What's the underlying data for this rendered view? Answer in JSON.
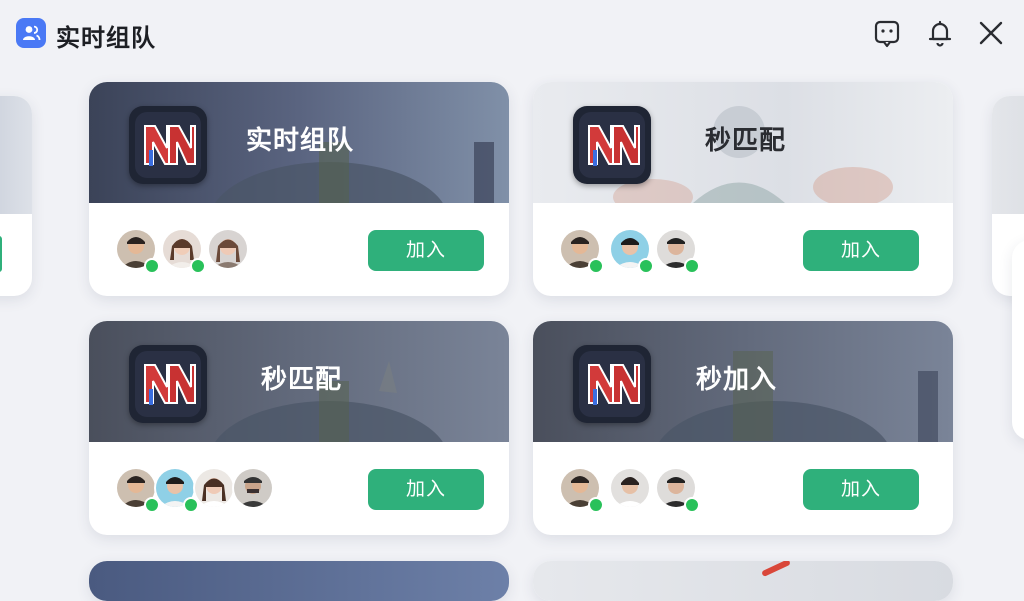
{
  "header": {
    "title": "实时组队",
    "icons": [
      "team-icon",
      "feedback-icon",
      "bell-icon",
      "close-icon"
    ]
  },
  "cards": [
    {
      "mode": "实时组队",
      "button": "加入",
      "banner_theme": "dark",
      "avatars": [
        {
          "online": true
        },
        {
          "online": true
        },
        {
          "online": false
        }
      ]
    },
    {
      "mode": "秒匹配",
      "button": "加入",
      "banner_theme": "light",
      "avatars": [
        {
          "online": true
        },
        {
          "online": true
        },
        {
          "online": true
        }
      ]
    },
    {
      "mode": "秒匹配",
      "button": "加入",
      "banner_theme": "dark",
      "avatars": [
        {
          "online": true
        },
        {
          "online": true
        },
        {
          "online": false
        },
        {
          "online": false
        }
      ]
    },
    {
      "mode": "秒加入",
      "button": "加入",
      "banner_theme": "dark",
      "avatars": [
        {
          "online": true
        },
        {
          "online": false
        },
        {
          "online": true
        }
      ]
    }
  ],
  "colors": {
    "accent_button": "#2fb07b",
    "online_dot": "#29c15a",
    "app_icon_bg": "#4a79f5"
  }
}
